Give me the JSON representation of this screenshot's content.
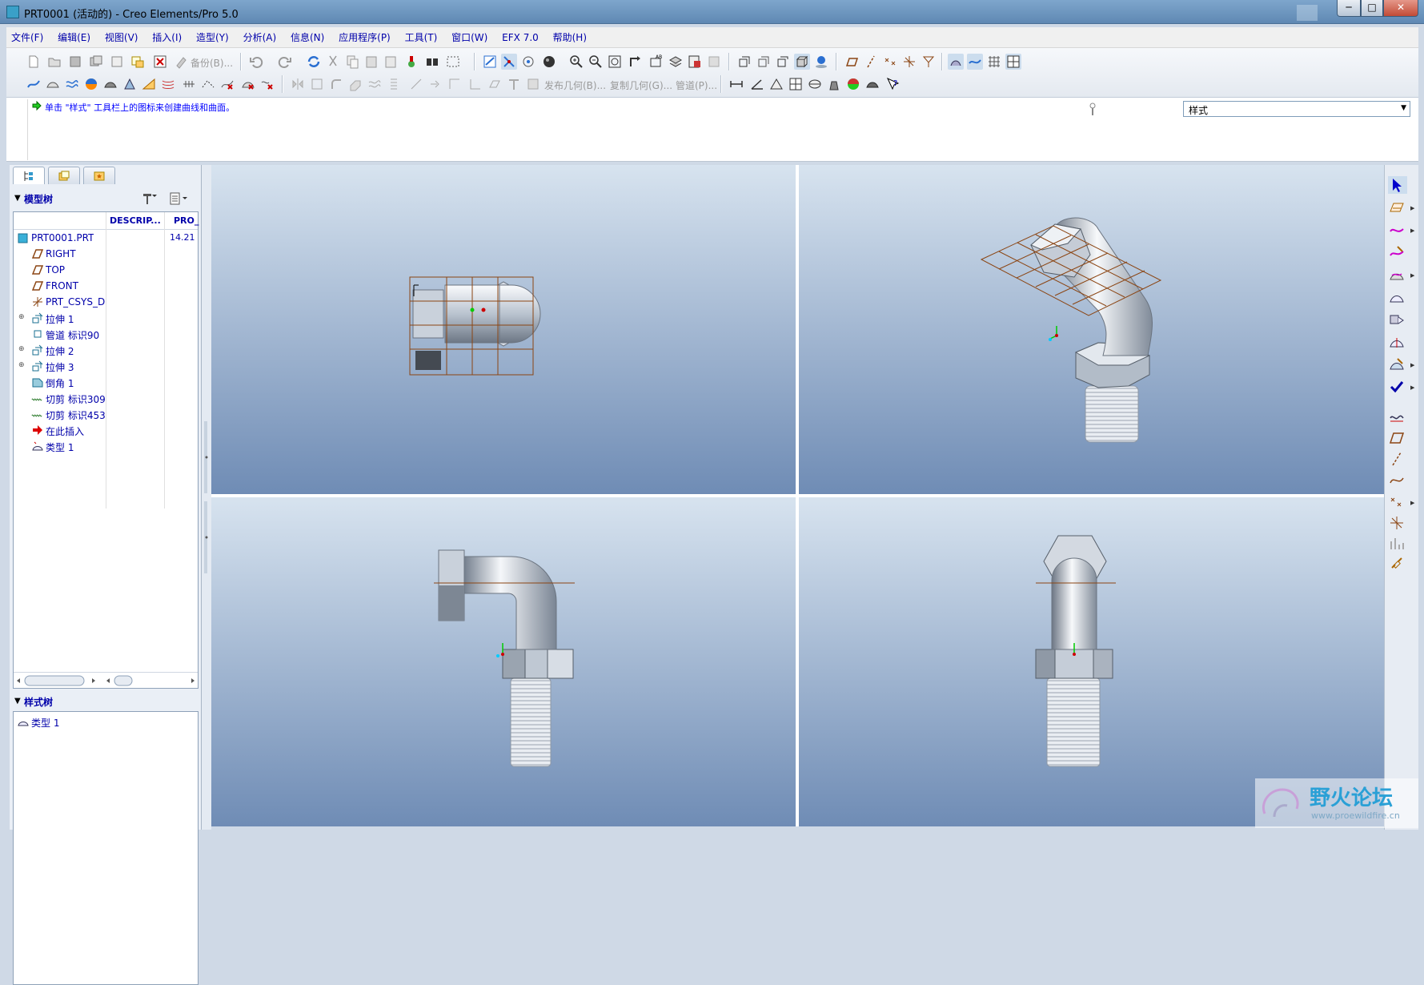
{
  "window": {
    "title": "PRT0001 (活动的) - Creo Elements/Pro 5.0",
    "min": "─",
    "max": "□",
    "close": "✕"
  },
  "menubar": [
    "文件(F)",
    "编辑(E)",
    "视图(V)",
    "插入(I)",
    "造型(Y)",
    "分析(A)",
    "信息(N)",
    "应用程序(P)",
    "工具(T)",
    "窗口(W)",
    "EFX 7.0",
    "帮助(H)"
  ],
  "toolbar": {
    "backup_label": "备份(B)...",
    "publish_geom_label": "发布几何(B)...",
    "copy_geom_label": "复制几何(G)...",
    "pipe_label": "管道(P)..."
  },
  "message": {
    "text": "单击 \"样式\" 工具栏上的图标来创建曲线和曲面。"
  },
  "filter": {
    "value": "样式"
  },
  "model_tree": {
    "title": "模型树",
    "columns": [
      "DESCRIP...",
      "PRO_"
    ],
    "root": {
      "label": "PRT0001.PRT",
      "value": "14.21"
    },
    "items": [
      {
        "label": "RIGHT",
        "icon": "datum-plane-icon",
        "expandable": false
      },
      {
        "label": "TOP",
        "icon": "datum-plane-icon",
        "expandable": false
      },
      {
        "label": "FRONT",
        "icon": "datum-plane-icon",
        "expandable": false
      },
      {
        "label": "PRT_CSYS_D",
        "icon": "csys-icon",
        "expandable": false
      },
      {
        "label": "拉伸 1",
        "icon": "extrude-icon",
        "expandable": true
      },
      {
        "label": "管道 标识90",
        "icon": "pipe-icon",
        "expandable": false
      },
      {
        "label": "拉伸 2",
        "icon": "extrude-icon",
        "expandable": true
      },
      {
        "label": "拉伸 3",
        "icon": "extrude-icon",
        "expandable": true
      },
      {
        "label": "倒角 1",
        "icon": "chamfer-icon",
        "expandable": false
      },
      {
        "label": "切剪 标识309",
        "icon": "cosmetic-thread-icon",
        "expandable": false
      },
      {
        "label": "切剪 标识453",
        "icon": "cosmetic-thread-icon",
        "expandable": false
      },
      {
        "label": "在此插入",
        "icon": "insert-here-arrow-icon",
        "expandable": false
      },
      {
        "label": "类型 1",
        "icon": "style-feature-icon",
        "expandable": false
      }
    ],
    "scroll_thumb": "···"
  },
  "style_tree": {
    "title": "样式树",
    "items": [
      {
        "label": "类型 1",
        "icon": "style-feature-icon"
      }
    ]
  },
  "watermark": {
    "title": "野火论坛",
    "url": "www.proewildfire.cn"
  },
  "colors": {
    "accent_text": "#0000aa",
    "viewport_top": "#d7e3ef",
    "viewport_bottom": "#6f8cb5",
    "model_edge": "#8b4513"
  }
}
